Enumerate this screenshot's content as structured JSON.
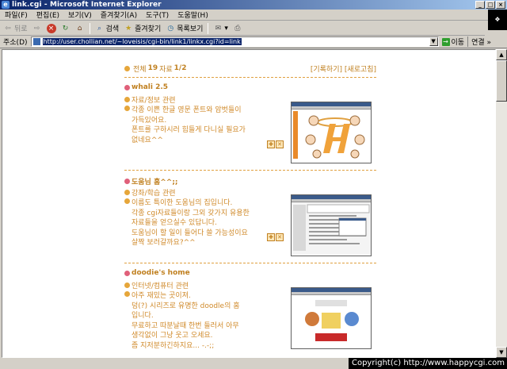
{
  "window": {
    "title": "link.cgi - Microsoft Internet Explorer",
    "app_icon": "ie-icon",
    "controls": [
      "_",
      "□",
      "×"
    ]
  },
  "menu": [
    "파일(F)",
    "편집(E)",
    "보기(V)",
    "즐겨찾기(A)",
    "도구(T)",
    "도움말(H)"
  ],
  "toolbar": {
    "back": "뒤로",
    "search": "검색",
    "favorites": "즐겨찾기",
    "history": "목록보기"
  },
  "address": {
    "label": "주소(D)",
    "url": "http://user.chollian.net/~loveisis/cgi-bin/link1/linkx.cgi?id=link",
    "go": "이동",
    "links": "연결 »"
  },
  "page": {
    "header_prefix": "전체",
    "header_count": "19",
    "header_mid": "자료",
    "header_page": "1/2",
    "header_actions": "[기록하기] [새로고침]",
    "entries": [
      {
        "name": "whali 2.5",
        "category": "자료/정보 관련",
        "description": "각종 이쁜 한글 영문 폰트와 암벗들이\n가득있어요.\n폰트를 구하시러 힘들게 다니실 필요가\n없네요^^",
        "thumb_kind": "orange"
      },
      {
        "name": "도움님 홈^^;;",
        "category": "강좌/학습 관련",
        "description": "이름도 특이한 도움님의 집입니다.\n각종 cgi자료들이랑 그외 갖가지 유용한\n자료들을 얻으실수 있답니다.\n도움님이 할 일이 들어다 쓸 가능성이요\n살짝 보러갈까요?^^",
        "thumb_kind": "window"
      },
      {
        "name": "doodie's home",
        "category": "인터넷/컴퓨터 관련",
        "description": "아주 재밌는 곳이져.\n덩(?) 시리즈로 유명한 doodle의 홈\n입니다.\n무료하고 따분날때 한번 들러서 아무\n생각없이 그냥 웃고 오세요.\n좀 지저분하긴하지요... -.-;;",
        "thumb_kind": "doodle"
      }
    ],
    "ctrl_labels": [
      "[",
      "]"
    ]
  },
  "watermark": "Copyright(c) http://www.happycgi.com",
  "colors": {
    "accent": "#c08020",
    "title_bar": "#0a246a"
  }
}
